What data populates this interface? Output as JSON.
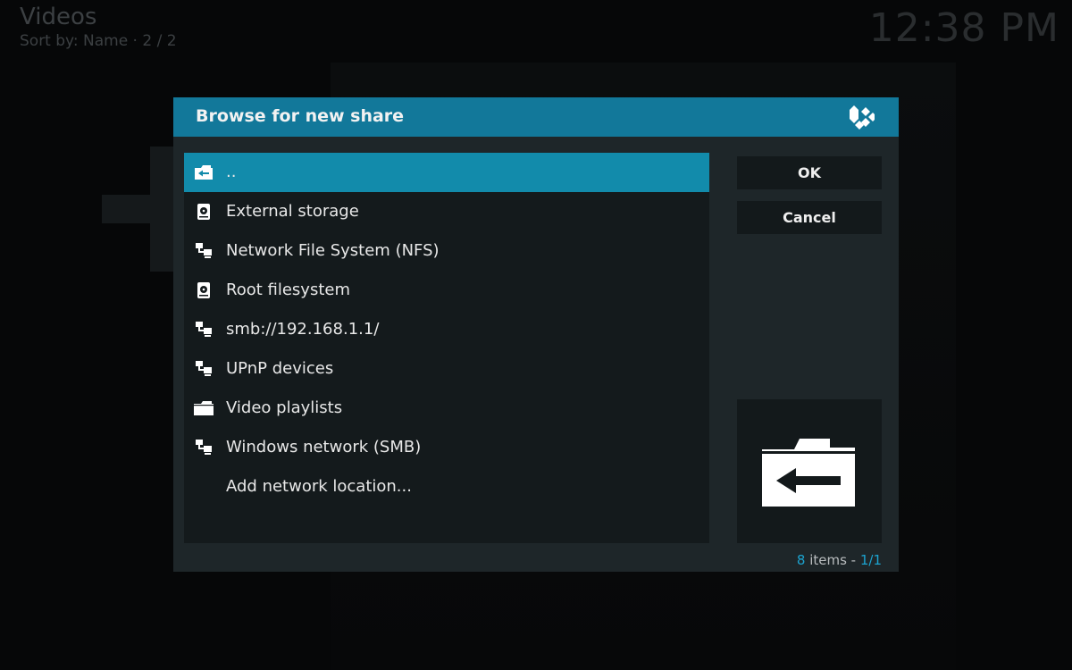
{
  "header": {
    "title": "Videos",
    "sort": "Sort by: Name  ·  2 / 2",
    "clock": "12:38 PM"
  },
  "dialog": {
    "title": "Browse for new share",
    "items": [
      {
        "label": "..",
        "icon": "folder-back-icon",
        "selected": true
      },
      {
        "label": "External storage",
        "icon": "hard-disk-icon"
      },
      {
        "label": "Network File System (NFS)",
        "icon": "network-icon"
      },
      {
        "label": "Root filesystem",
        "icon": "hard-disk-icon"
      },
      {
        "label": "smb://192.168.1.1/",
        "icon": "network-icon"
      },
      {
        "label": "UPnP devices",
        "icon": "network-icon"
      },
      {
        "label": "Video playlists",
        "icon": "folder-icon"
      },
      {
        "label": "Windows network (SMB)",
        "icon": "network-icon"
      },
      {
        "label": "Add network location...",
        "icon": ""
      }
    ],
    "ok_label": "OK",
    "cancel_label": "Cancel",
    "preview_icon": "folder-back-icon",
    "footer": {
      "count": "8",
      "items_text": " items - ",
      "page": "1/1"
    }
  },
  "colors": {
    "header_bar": "#12789a",
    "selected_row": "#128bab",
    "accent_text": "#1ca3cf"
  }
}
